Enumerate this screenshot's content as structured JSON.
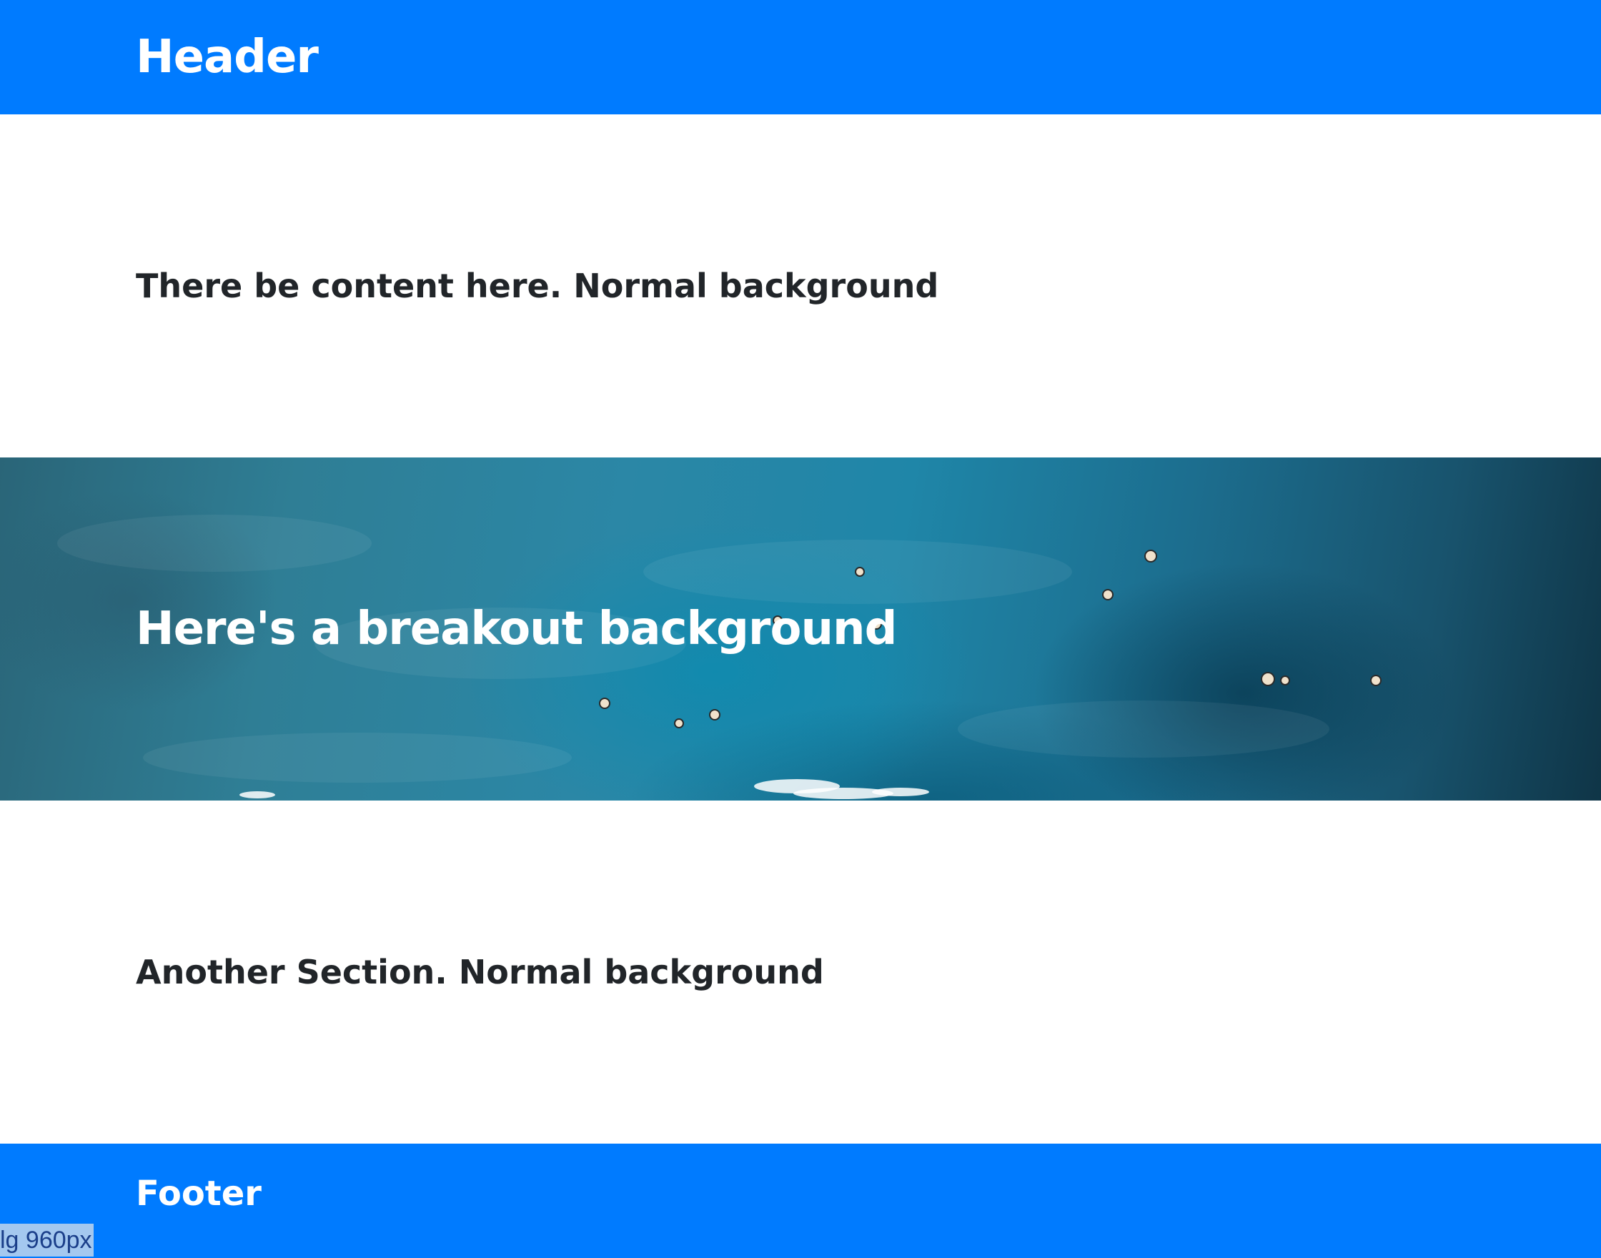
{
  "header": {
    "title": "Header"
  },
  "sections": {
    "first": {
      "heading": "There be content here. Normal background"
    },
    "breakout": {
      "heading": "Here's a breakout background"
    },
    "second": {
      "heading": "Another Section. Normal background"
    }
  },
  "footer": {
    "title": "Footer"
  },
  "breakpoint_badge": {
    "label": "lg 960px"
  },
  "colors": {
    "brand_blue": "#007bff",
    "heading_text": "#212529",
    "ocean_dark": "#0f3547",
    "ocean_mid": "#2b87a6",
    "badge_bg": "#adccee"
  }
}
